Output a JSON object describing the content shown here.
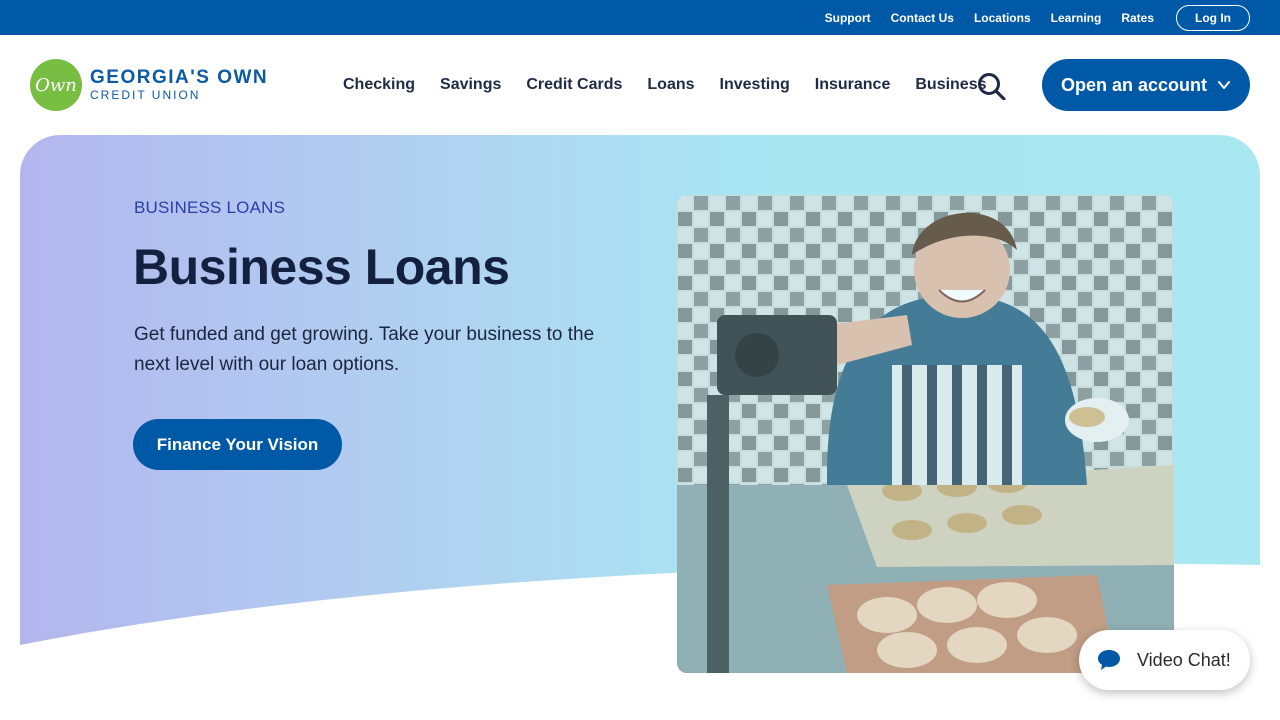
{
  "utility": {
    "links": [
      "Support",
      "Contact Us",
      "Locations",
      "Learning",
      "Rates"
    ],
    "login": "Log In"
  },
  "logo": {
    "mark": "Own",
    "name_line1": "GEORGIA'S OWN",
    "name_line2": "CREDIT UNION"
  },
  "nav": {
    "items": [
      "Checking",
      "Savings",
      "Credit Cards",
      "Loans",
      "Investing",
      "Insurance",
      "Business"
    ],
    "search_icon": "search-icon",
    "open_account": "Open an account"
  },
  "hero": {
    "eyebrow": "BUSINESS LOANS",
    "title": "Business Loans",
    "description": "Get funded and get growing. Take your business to the next level with our loan options.",
    "cta": "Finance Your Vision",
    "image_icon": "baker-photo"
  },
  "chat": {
    "label": "Video Chat!",
    "icon": "chat-bubble-icon"
  },
  "colors": {
    "brand_blue": "#0059a7",
    "logo_green": "#78be43",
    "heading_navy": "#14203f",
    "eyebrow_blue": "#2c3ea8"
  }
}
